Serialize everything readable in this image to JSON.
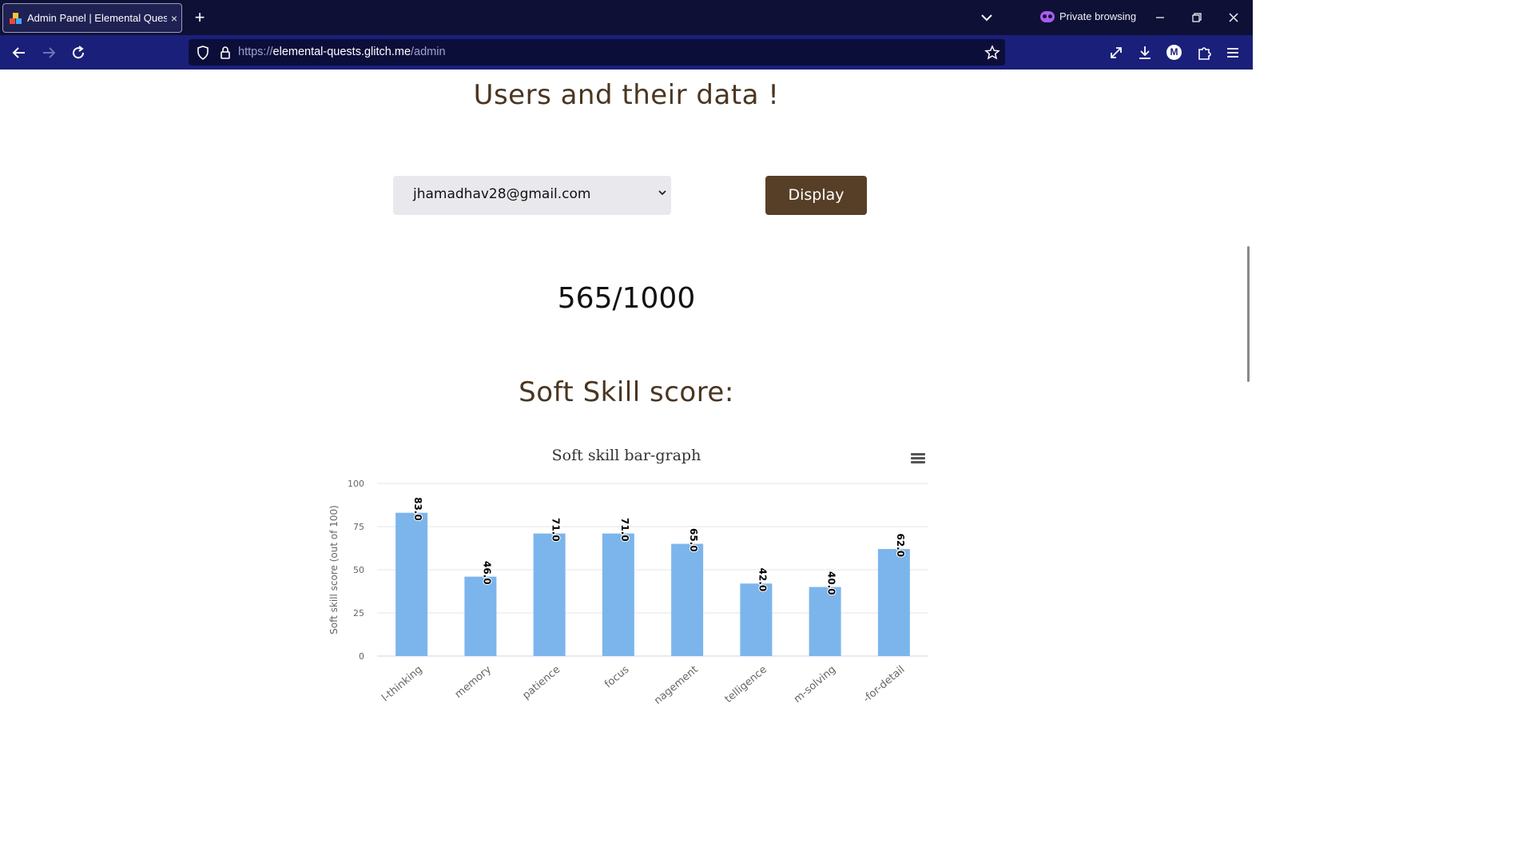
{
  "browser": {
    "tab": {
      "title": "Admin Panel | Elemental Quests",
      "close": "×"
    },
    "new_tab": "+",
    "private_label": "Private browsing",
    "url": {
      "scheme": "https://",
      "host": "elemental-quests.glitch.me",
      "path": "/admin"
    },
    "profile_initial": "M",
    "window_controls": [
      "minimize-icon",
      "restore-icon",
      "close-icon"
    ]
  },
  "page": {
    "title": "Users and their data !",
    "user_select": {
      "selected": "jhamadhav28@gmail.com"
    },
    "display_button": "Display",
    "score": "565/1000",
    "soft_skill_title": "Soft Skill score:"
  },
  "chart_data": {
    "type": "bar",
    "title": "Soft skill bar-graph",
    "ylabel": "Soft skill score (out of 100)",
    "xlabel": "",
    "ylim": [
      0,
      100
    ],
    "yticks": [
      0,
      25,
      50,
      75,
      100
    ],
    "categories": [
      "l-thinking",
      "memory",
      "patience",
      "focus",
      "nagement",
      "telligence",
      "m-solving",
      "-for-detail"
    ],
    "values": [
      83,
      46,
      71,
      71,
      65,
      42,
      40,
      62
    ],
    "data_labels": [
      "83.0",
      "46.0",
      "71.0",
      "71.0",
      "65.0",
      "42.0",
      "40.0",
      "62.0"
    ],
    "bar_color": "#7cb5ec",
    "grid": true
  }
}
